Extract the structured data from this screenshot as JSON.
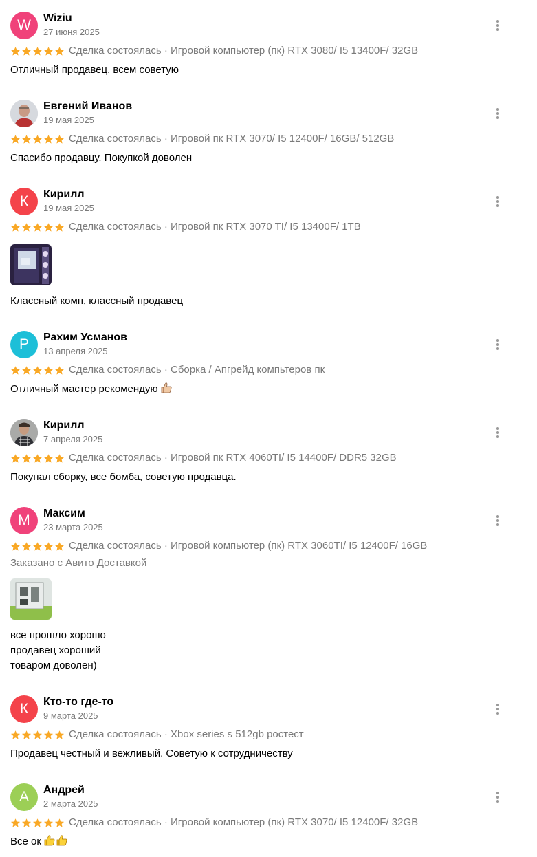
{
  "reviews": [
    {
      "name": "Wiziu",
      "date": "27 июня 2025",
      "avatar_letter": "W",
      "avatar_color": "#f0427a",
      "meta": "Сделка состоялась · Игровой компьютер (пк) RTX 3080/ I5 13400F/ 32GB",
      "text": "Отличный продавец, всем советую"
    },
    {
      "name": "Евгений Иванов",
      "date": "19 мая 2025",
      "meta": "Сделка состоялась · Игровой пк RTX 3070/ I5 12400F/ 16GB/ 512GB",
      "text": "Спасибо продавцу. Покупкой доволен"
    },
    {
      "name": "Кирилл",
      "date": "19 мая 2025",
      "avatar_letter": "К",
      "avatar_color": "#f4434a",
      "meta": "Сделка состоялась · Игровой пк RTX 3070 TI/ I5 13400F/ 1TB",
      "text": "Классный комп, классный продавец"
    },
    {
      "name": "Рахим Усманов",
      "date": "13 апреля 2025",
      "avatar_letter": "Р",
      "avatar_color": "#1dbfd8",
      "meta": "Сделка состоялась · Сборка / Апгрейд компьтеров пк",
      "text": "Отличный мастер рекомендую"
    },
    {
      "name": "Кирилл",
      "date": "7 апреля 2025",
      "meta": "Сделка состоялась · Игровой пк RTX 4060TI/ I5 14400F/ DDR5 32GB",
      "text": "Покупал сборку, все бомба, советую продавца."
    },
    {
      "name": "Максим",
      "date": "23 марта 2025",
      "avatar_letter": "М",
      "avatar_color": "#f0427a",
      "meta": "Сделка состоялась · Игровой компьютер (пк) RTX 3060TI/ I5 12400F/ 16GB",
      "delivery": "Заказано с Авито Доставкой",
      "text_lines": [
        "все прошло хорошо",
        "продавец хороший",
        "товаром доволен)"
      ]
    },
    {
      "name": "Кто-то где-то",
      "date": "9 марта 2025",
      "avatar_letter": "К",
      "avatar_color": "#f4434a",
      "meta": "Сделка состоялась · Xbox series s 512gb ростест",
      "text": "Продавец честный и вежливый. Советую к сотрудничеству"
    },
    {
      "name": "Андрей",
      "date": "2 марта 2025",
      "avatar_letter": "А",
      "avatar_color": "#9ccf56",
      "meta": "Сделка состоялась · Игровой компьютер (пк) RTX 3070/ I5 12400F/ 32GB",
      "text": "Все ок"
    }
  ],
  "rating_stars": 5,
  "star_color": "#f9a825",
  "icons": {
    "menu": "kebab-menu-icon",
    "star": "star-icon",
    "thumbs": "thumbs-up-emoji"
  }
}
